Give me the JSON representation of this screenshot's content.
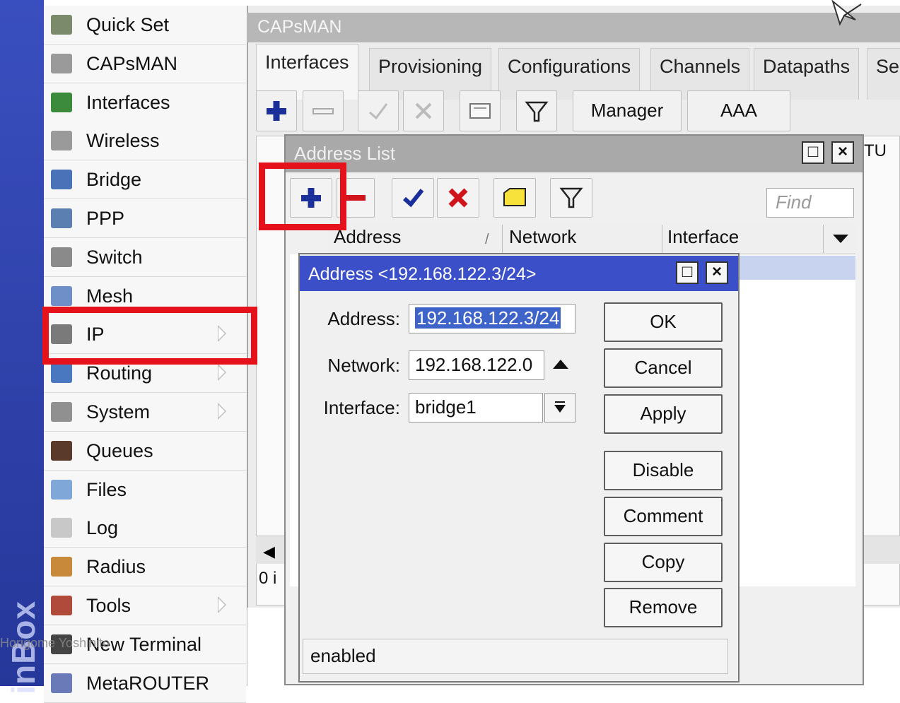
{
  "brand": {
    "text": "inBox"
  },
  "watermark": "Horigome Yoshihito",
  "sidebar": {
    "items": [
      {
        "label": "Quick Set",
        "icon": "quick-set-icon",
        "submenu": false
      },
      {
        "label": "CAPsMAN",
        "icon": "capsman-icon",
        "submenu": false
      },
      {
        "label": "Interfaces",
        "icon": "interfaces-icon",
        "submenu": false
      },
      {
        "label": "Wireless",
        "icon": "wireless-icon",
        "submenu": false
      },
      {
        "label": "Bridge",
        "icon": "bridge-icon",
        "submenu": false
      },
      {
        "label": "PPP",
        "icon": "ppp-icon",
        "submenu": false
      },
      {
        "label": "Switch",
        "icon": "switch-icon",
        "submenu": false
      },
      {
        "label": "Mesh",
        "icon": "mesh-icon",
        "submenu": false
      },
      {
        "label": "IP",
        "icon": "ip-icon",
        "submenu": true
      },
      {
        "label": "Routing",
        "icon": "routing-icon",
        "submenu": true
      },
      {
        "label": "System",
        "icon": "system-icon",
        "submenu": true
      },
      {
        "label": "Queues",
        "icon": "queues-icon",
        "submenu": false
      },
      {
        "label": "Files",
        "icon": "files-icon",
        "submenu": false
      },
      {
        "label": "Log",
        "icon": "log-icon",
        "submenu": false
      },
      {
        "label": "Radius",
        "icon": "radius-icon",
        "submenu": false
      },
      {
        "label": "Tools",
        "icon": "tools-icon",
        "submenu": true
      },
      {
        "label": "New Terminal",
        "icon": "terminal-icon",
        "submenu": false
      },
      {
        "label": "MetaROUTER",
        "icon": "metarouter-icon",
        "submenu": false
      }
    ]
  },
  "capsman": {
    "title": "CAPsMAN",
    "tabs": [
      "Interfaces",
      "Provisioning",
      "Configurations",
      "Channels",
      "Datapaths",
      "Se"
    ],
    "toolbar": {
      "manager_label": "Manager",
      "aaa_label": "AAA"
    },
    "column_fragment": "TU",
    "item_count": "0 i"
  },
  "address_list": {
    "title": "Address List",
    "find_placeholder": "Find",
    "columns": [
      "Address",
      "Network",
      "Interface"
    ],
    "sort_indicator": "/"
  },
  "dialog": {
    "title": "Address <192.168.122.3/24>",
    "fields": {
      "address_label": "Address:",
      "address_value": "192.168.122.3/24",
      "network_label": "Network:",
      "network_value": "192.168.122.0",
      "interface_label": "Interface:",
      "interface_value": "bridge1"
    },
    "buttons": [
      "OK",
      "Cancel",
      "Apply",
      "Disable",
      "Comment",
      "Copy",
      "Remove"
    ],
    "status": "enabled"
  },
  "colors": {
    "dialog_title": "#3b4fc9",
    "highlight": "#e5121b",
    "brand_bar": "#3a4fbf"
  }
}
